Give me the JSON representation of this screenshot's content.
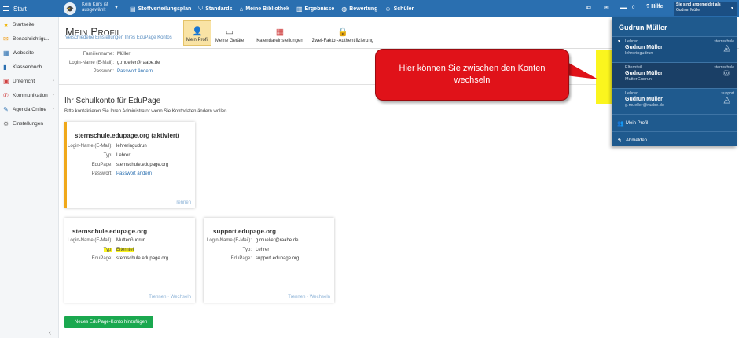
{
  "topbar": {
    "start": "Start",
    "course_line1": "Kein Kurs ist",
    "course_line2": "ausgewählt",
    "nav": [
      {
        "icon": "document-icon",
        "glyph": "▤",
        "label": "Stoffverteilungsplan"
      },
      {
        "icon": "shield-icon",
        "glyph": "⛉",
        "label": "Standards"
      },
      {
        "icon": "library-icon",
        "glyph": "⌂",
        "label": "Meine Bibliothek"
      },
      {
        "icon": "chart-icon",
        "glyph": "▥",
        "label": "Ergebnisse"
      },
      {
        "icon": "grade-icon",
        "glyph": "◍",
        "label": "Bewertung"
      },
      {
        "icon": "students-icon",
        "glyph": "☺",
        "label": "Schüler"
      }
    ],
    "messages_count": "0",
    "help": "Hilfe",
    "logged_in_as": "Sie sind angemeldet als",
    "logged_user": "Gudrun Müller"
  },
  "sidebar": {
    "items": [
      {
        "icon": "star-icon",
        "glyph": "★",
        "color": "#f0b400",
        "label": "Startseite"
      },
      {
        "icon": "notification-icon",
        "glyph": "✉",
        "color": "#f0a020",
        "label": "Benachrichtigu..."
      },
      {
        "icon": "website-icon",
        "glyph": "▦",
        "color": "#2a6fb0",
        "label": "Webseite"
      },
      {
        "icon": "classbook-icon",
        "glyph": "▮",
        "color": "#2a6fb0",
        "label": "Klassenbuch"
      },
      {
        "icon": "lesson-icon",
        "glyph": "▣",
        "color": "#d04040",
        "label": "Unterricht"
      },
      {
        "icon": "communication-icon",
        "glyph": "✆",
        "color": "#d04040",
        "label": "Kommunikation"
      },
      {
        "icon": "agenda-icon",
        "glyph": "✎",
        "color": "#2a6fb0",
        "label": "Agenda Online"
      },
      {
        "icon": "settings-icon",
        "glyph": "⚙",
        "color": "#777777",
        "label": "Einstellungen"
      }
    ]
  },
  "header": {
    "title": "Mein Profil",
    "subtitle": "Verschiedene Einstellungen Ihres EduPage Kontos",
    "tools": [
      "Mein Profil",
      "Meine Geräte",
      "Kalendareinstellungen",
      "Zwei-Faktor-Authentifizierung"
    ]
  },
  "profile": {
    "surname_label": "Familienname:",
    "surname": "Müller",
    "login_label": "Login-Name (E-Mail):",
    "login": "g.mueller@raabe.de",
    "password_label": "Passwort:",
    "password_link": "Passwort ändern"
  },
  "school_section": {
    "title": "Ihr Schulkonto für EduPage",
    "subtitle": "Bitte kontaktieren Sie Ihren Administrator wenn Sie Kontodaten ändern wollen"
  },
  "cards": [
    {
      "title": "sternschule.edupage.org (aktiviert)",
      "login": "lehreringudrun",
      "typ": "Lehrer",
      "edupage": "sternschule.edupage.org",
      "password_link": "Passwort ändern",
      "actions": "Trennen"
    },
    {
      "title": "sternschule.edupage.org",
      "login": "MutterGudrun",
      "typ": "Elternteil",
      "edupage": "sternschule.edupage.org",
      "actions": "Trennen · Wechseln"
    },
    {
      "title": "support.edupage.org",
      "login": "g.mueller@raabe.de",
      "typ": "Lehrer",
      "edupage": "support.edupage.org",
      "actions": "Trennen · Wechseln"
    }
  ],
  "labels": {
    "login": "Login-Name (E-Mail):",
    "typ": "Typ:",
    "edupage": "EduPage:",
    "password": "Passwort:"
  },
  "add_button": "+ Neues EduPage-Konto hinzufügen",
  "callout": "Hier können Sie zwischen den Konten wechseln",
  "panel": {
    "name": "Gudrun Müller",
    "accounts": [
      {
        "type": "Lehrer",
        "name": "Gudrun Müller",
        "login": "lehreringudrun",
        "school": "sternschule"
      },
      {
        "type": "Elternteil",
        "name": "Gudrun Müller",
        "login": "MutterGudrun",
        "school": "sternschule"
      },
      {
        "type": "Lehrer",
        "name": "Gudrun Müller",
        "login": "g.mueller@raabe.de",
        "school": "support"
      }
    ],
    "my_profile": "Mein Profil",
    "logout": "Abmelden"
  }
}
